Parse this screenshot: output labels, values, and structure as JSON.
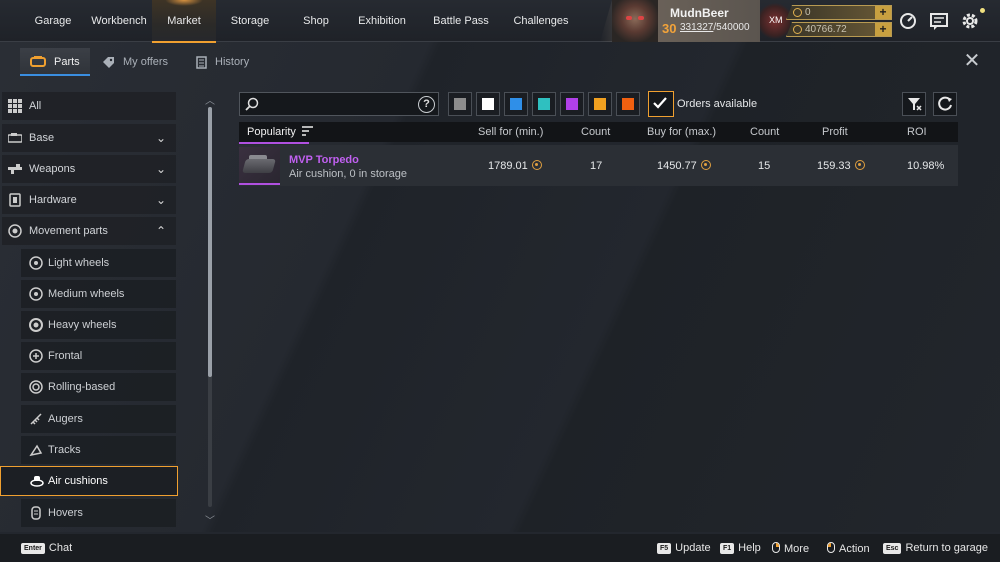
{
  "nav": {
    "tabs": [
      {
        "label": "Garage"
      },
      {
        "label": "Workbench"
      },
      {
        "label": "Market"
      },
      {
        "label": "Storage"
      },
      {
        "label": "Shop"
      },
      {
        "label": "Exhibition"
      },
      {
        "label": "Battle Pass"
      },
      {
        "label": "Challenges"
      }
    ],
    "active_tab": "Market"
  },
  "user": {
    "name": "MudnBeer",
    "level": "30",
    "xp_current": "331327",
    "xp_separator": "/",
    "xp_max": "540000",
    "badge_text": "XM",
    "currency1": "0",
    "currency2": "40766.72"
  },
  "subtabs": [
    {
      "label": "Parts"
    },
    {
      "label": "My offers"
    },
    {
      "label": "History"
    }
  ],
  "sidebar": {
    "categories": [
      {
        "label": "All",
        "icon": "grid-icon"
      },
      {
        "label": "Base",
        "icon": "cabin-icon"
      },
      {
        "label": "Weapons",
        "icon": "weapon-icon"
      },
      {
        "label": "Hardware",
        "icon": "hardware-icon"
      },
      {
        "label": "Movement parts",
        "icon": "movement-icon"
      }
    ],
    "movement_items": [
      {
        "label": "Light wheels",
        "icon": "wheel-icon"
      },
      {
        "label": "Medium wheels",
        "icon": "wheel-icon"
      },
      {
        "label": "Heavy wheels",
        "icon": "wheel-icon"
      },
      {
        "label": "Frontal",
        "icon": "frontal-icon"
      },
      {
        "label": "Rolling-based",
        "icon": "rolling-icon"
      },
      {
        "label": "Augers",
        "icon": "auger-icon"
      },
      {
        "label": "Tracks",
        "icon": "track-icon"
      },
      {
        "label": "Air cushions",
        "icon": "air-cushion-icon",
        "selected": true
      },
      {
        "label": "Hovers",
        "icon": "hover-icon"
      }
    ]
  },
  "filters": {
    "search_value": "",
    "help_label": "?",
    "rarity_colors": [
      "#8c8c8c",
      "#ffffff",
      "#2f8fe8",
      "#2fc0c0",
      "#b040e8",
      "#f0a020",
      "#f06010"
    ],
    "orders_available_label": "Orders available",
    "orders_available_checked": true
  },
  "table": {
    "columns": [
      "Popularity",
      "Sell for (min.)",
      "Count",
      "Buy for (max.)",
      "Count",
      "Profit",
      "ROI"
    ],
    "rows": [
      {
        "name": "MVP Torpedo",
        "subtitle": "Air cushion, 0 in storage",
        "sell_min": "1789.01",
        "sell_count": "17",
        "buy_max": "1450.77",
        "buy_count": "15",
        "profit": "159.33",
        "roi": "10.98%",
        "rarity_color": "#b040e8"
      }
    ]
  },
  "bottom": {
    "chat_key": "Enter",
    "chat_label": "Chat",
    "update_key": "F5",
    "update_label": "Update",
    "help_key": "F1",
    "help_label": "Help",
    "more_label": "More",
    "action_label": "Action",
    "return_key": "Esc",
    "return_label": "Return to garage"
  }
}
